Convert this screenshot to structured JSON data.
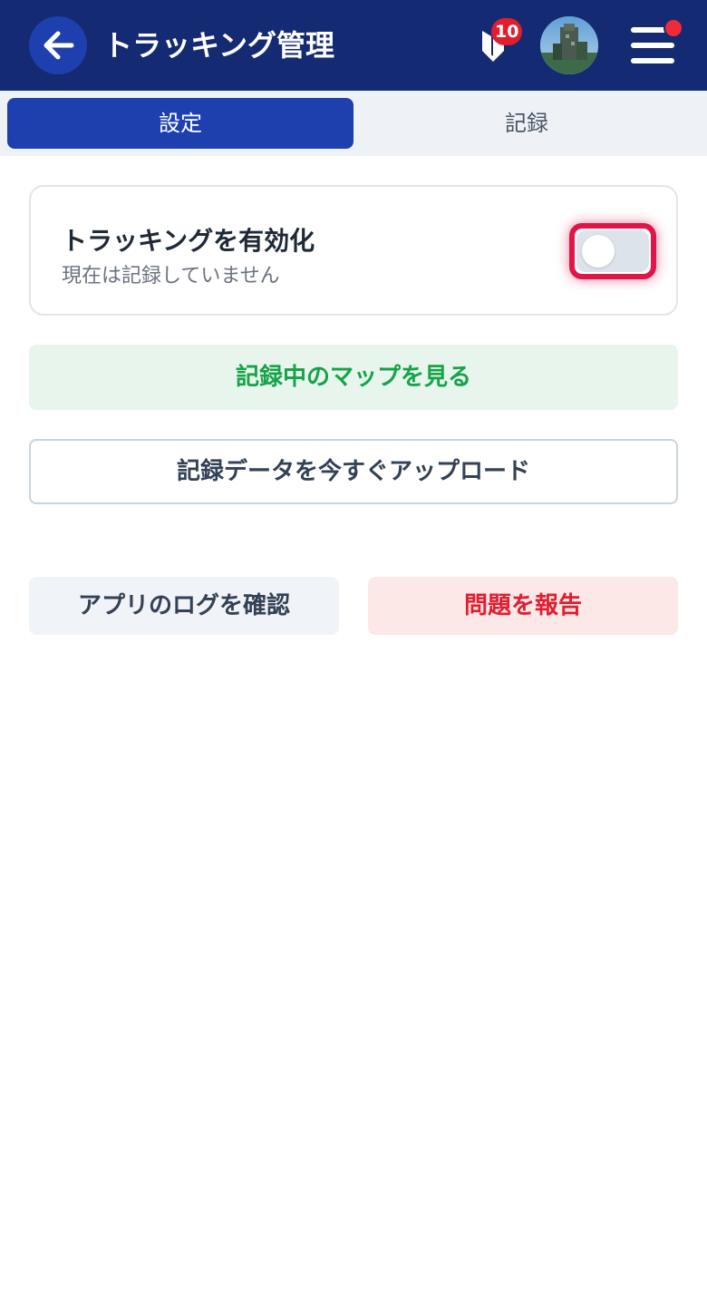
{
  "header": {
    "title": "トラッキング管理",
    "back_icon": "arrow-left-icon",
    "notification_count": "10",
    "notification_icon": "shield-badge-icon",
    "menu_icon": "hamburger-menu-icon",
    "menu_has_alert": true,
    "colors": {
      "background": "#142a73",
      "back_button": "#1e40af",
      "badge": "#e11d2e"
    }
  },
  "tabs": [
    {
      "label": "設定",
      "active": true
    },
    {
      "label": "記録",
      "active": false
    }
  ],
  "tracking": {
    "title": "トラッキングを有効化",
    "status": "現在は記録していません",
    "enabled": false
  },
  "buttons": {
    "view_map": "記録中のマップを見る",
    "upload_now": "記録データを今すぐアップロード",
    "view_logs": "アプリのログを確認",
    "report_issue": "問題を報告"
  },
  "colors": {
    "accent": "#1e40af",
    "success": "#16a34a",
    "danger": "#e11d2e",
    "focus_ring": "#e0164a"
  }
}
